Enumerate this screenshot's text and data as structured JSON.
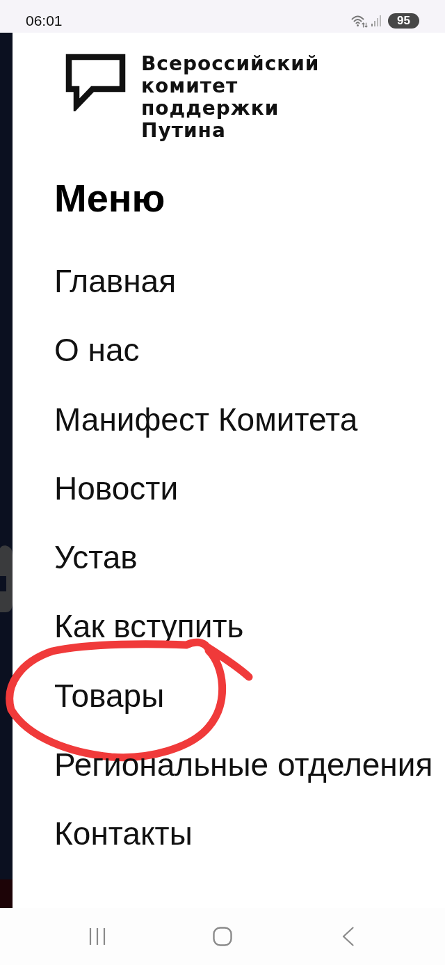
{
  "status_bar": {
    "time": "06:01",
    "battery": "95"
  },
  "logo": {
    "lines": [
      "Всероссийский",
      "комитет",
      "поддержки",
      "Путина"
    ]
  },
  "menu": {
    "title": "Меню",
    "items": [
      {
        "label": "Главная",
        "circled": false
      },
      {
        "label": "О нас",
        "circled": false
      },
      {
        "label": "Манифест Комитета",
        "circled": false
      },
      {
        "label": "Новости",
        "circled": false
      },
      {
        "label": "Устав",
        "circled": false
      },
      {
        "label": "Как вступить",
        "circled": false
      },
      {
        "label": "Товары",
        "circled": true
      },
      {
        "label": "Региональные отделения",
        "circled": false
      },
      {
        "label": "Контакты",
        "circled": false
      }
    ]
  }
}
